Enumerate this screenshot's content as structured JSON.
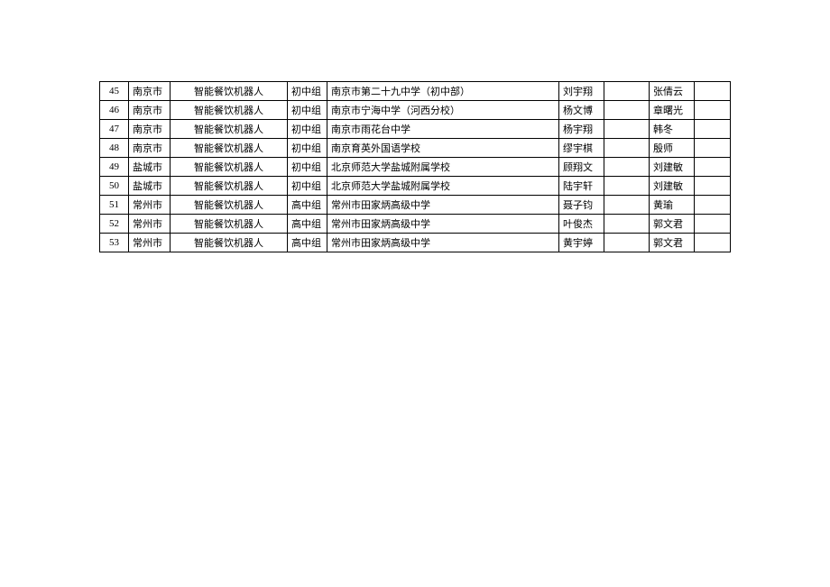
{
  "rows": [
    {
      "idx": "45",
      "city": "南京市",
      "category": "智能餐饮机器人",
      "group": "初中组",
      "school": "南京市第二十九中学（初中部）",
      "student": "刘宇翔",
      "blank": "",
      "teacher": "张倩云"
    },
    {
      "idx": "46",
      "city": "南京市",
      "category": "智能餐饮机器人",
      "group": "初中组",
      "school": "南京市宁海中学（河西分校）",
      "student": "杨文博",
      "blank": "",
      "teacher": "章曙光"
    },
    {
      "idx": "47",
      "city": "南京市",
      "category": "智能餐饮机器人",
      "group": "初中组",
      "school": "南京市雨花台中学",
      "student": "杨宇翔",
      "blank": "",
      "teacher": "韩冬"
    },
    {
      "idx": "48",
      "city": "南京市",
      "category": "智能餐饮机器人",
      "group": "初中组",
      "school": "南京育英外国语学校",
      "student": "缪宇棋",
      "blank": "",
      "teacher": "殷师"
    },
    {
      "idx": "49",
      "city": "盐城市",
      "category": "智能餐饮机器人",
      "group": "初中组",
      "school": "北京师范大学盐城附属学校",
      "student": "顾翔文",
      "blank": "",
      "teacher": "刘建敏"
    },
    {
      "idx": "50",
      "city": "盐城市",
      "category": "智能餐饮机器人",
      "group": "初中组",
      "school": "北京师范大学盐城附属学校",
      "student": "陆宇轩",
      "blank": "",
      "teacher": "刘建敏"
    },
    {
      "idx": "51",
      "city": "常州市",
      "category": "智能餐饮机器人",
      "group": "高中组",
      "school": "常州市田家炳高级中学",
      "student": "聂子钧",
      "blank": "",
      "teacher": "黄瑜"
    },
    {
      "idx": "52",
      "city": "常州市",
      "category": "智能餐饮机器人",
      "group": "高中组",
      "school": "常州市田家炳高级中学",
      "student": "叶俊杰",
      "blank": "",
      "teacher": "郭文君"
    },
    {
      "idx": "53",
      "city": "常州市",
      "category": "智能餐饮机器人",
      "group": "高中组",
      "school": "常州市田家炳高级中学",
      "student": "黄宇婷",
      "blank": "",
      "teacher": "郭文君"
    }
  ]
}
